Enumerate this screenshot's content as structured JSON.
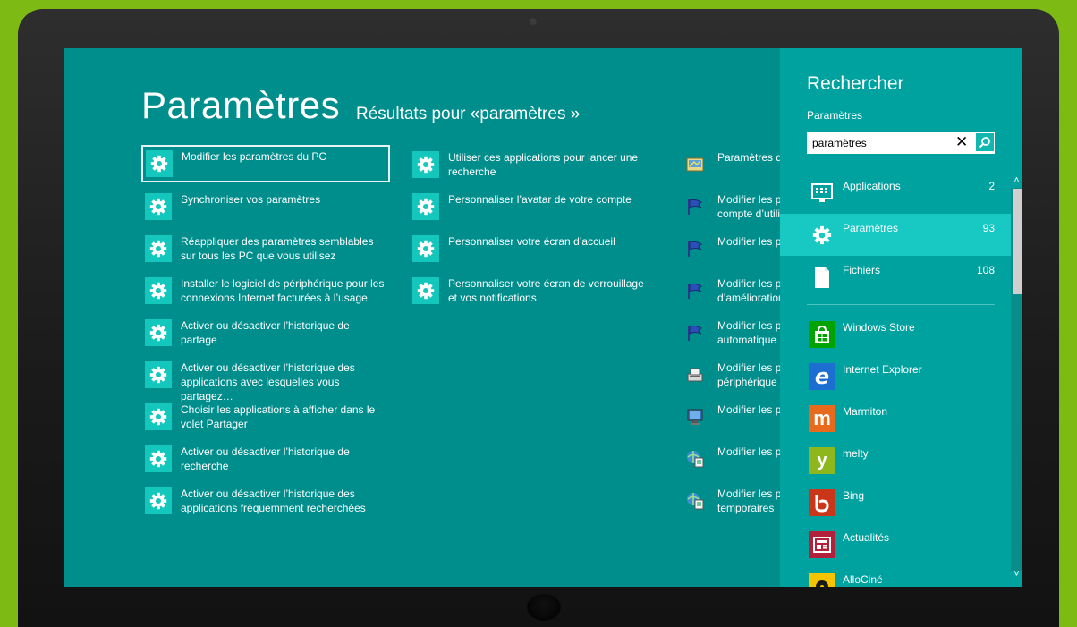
{
  "page": {
    "title": "Paramètres",
    "subtitle": "Résultats pour «paramètres »"
  },
  "results": {
    "column1": [
      {
        "label": "Modifier les paramètres du PC",
        "icon": "gear-icon"
      },
      {
        "label": "Synchroniser vos paramètres",
        "icon": "gear-icon"
      },
      {
        "label": "Réappliquer des paramètres semblables sur tous les PC que vous utilisez",
        "icon": "gear-icon"
      },
      {
        "label": "Installer le logiciel de périphérique pour les connexions Internet facturées à l’usage",
        "icon": "gear-icon"
      },
      {
        "label": "Activer ou désactiver l’historique de partage",
        "icon": "gear-icon"
      },
      {
        "label": "Activer ou désactiver l’historique des applications avec lesquelles vous partagez…",
        "icon": "gear-icon"
      },
      {
        "label": "Choisir les applications à afficher dans le volet Partager",
        "icon": "gear-icon"
      },
      {
        "label": "Activer ou désactiver l’historique de recherche",
        "icon": "gear-icon"
      },
      {
        "label": "Activer ou désactiver l’historique des applications fréquemment recherchées",
        "icon": "gear-icon"
      }
    ],
    "column2": [
      {
        "label": "Utiliser ces applications pour lancer une recherche",
        "icon": "gear-icon"
      },
      {
        "label": "Personnaliser l’avatar de votre compte",
        "icon": "gear-icon"
      },
      {
        "label": "Personnaliser votre écran d’accueil",
        "icon": "gear-icon"
      },
      {
        "label": "Personnaliser votre écran de verrouillage et vos notifications",
        "icon": "gear-icon"
      }
    ],
    "column3": [
      {
        "line1": "Paramètres de",
        "line2": "",
        "icon": "control-panel-icon"
      },
      {
        "line1": "Modifier les pa",
        "line2": "compte d’utili",
        "icon": "action-center-flag-icon"
      },
      {
        "line1": "Modifier les pa",
        "line2": "",
        "icon": "action-center-flag-icon"
      },
      {
        "line1": "Modifier les pa",
        "line2": "d’amélioration",
        "icon": "action-center-flag-icon"
      },
      {
        "line1": "Modifier les pa",
        "line2": "automatique",
        "icon": "action-center-flag-icon"
      },
      {
        "line1": "Modifier les pa",
        "line2": "périphérique",
        "icon": "device-settings-icon"
      },
      {
        "line1": "Modifier les pa",
        "line2": "",
        "icon": "display-icon"
      },
      {
        "line1": "Modifier les pa",
        "line2": "",
        "icon": "internet-options-icon"
      },
      {
        "line1": "Modifier les pa",
        "line2": "temporaires",
        "icon": "internet-options-icon"
      }
    ]
  },
  "search_panel": {
    "title": "Rechercher",
    "scope": "Paramètres",
    "query": "paramètres",
    "scopes": [
      {
        "label": "Applications",
        "count": "2",
        "icon": "applications-icon"
      },
      {
        "label": "Paramètres",
        "count": "93",
        "icon": "gear-icon"
      },
      {
        "label": "Fichiers",
        "count": "108",
        "icon": "file-icon"
      }
    ],
    "apps": [
      {
        "label": "Windows Store",
        "icon": "windows-store-icon",
        "color": "#00a300"
      },
      {
        "label": "Internet Explorer",
        "icon": "internet-explorer-icon",
        "color": "#1c6fd1"
      },
      {
        "label": "Marmiton",
        "icon": "marmiton-icon",
        "color": "#e86a1d"
      },
      {
        "label": "melty",
        "icon": "melty-icon",
        "color": "#8db71c"
      },
      {
        "label": "Bing",
        "icon": "bing-icon",
        "color": "#c9361a"
      },
      {
        "label": "Actualités",
        "icon": "news-icon",
        "color": "#b3203b"
      },
      {
        "label": "AlloCiné",
        "icon": "allocine-icon",
        "color": "#f5c300"
      }
    ]
  },
  "colors": {
    "background": "#008e8d",
    "panel": "#00a2a0",
    "tile": "#14c7bd",
    "outer": "#7dbb14"
  }
}
